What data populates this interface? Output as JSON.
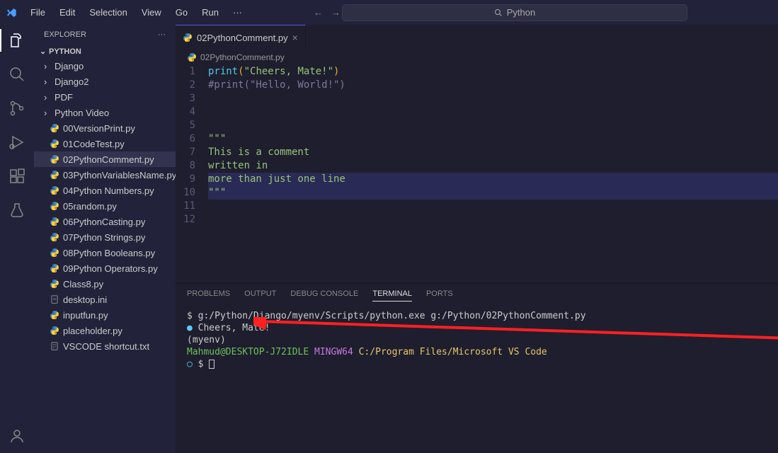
{
  "menu": [
    "File",
    "Edit",
    "Selection",
    "View",
    "Go",
    "Run"
  ],
  "search_placeholder": "Python",
  "sidebar": {
    "title": "EXPLORER",
    "folder": "PYTHON",
    "items": [
      {
        "type": "folder",
        "label": "Django"
      },
      {
        "type": "folder",
        "label": "Django2"
      },
      {
        "type": "folder",
        "label": "PDF"
      },
      {
        "type": "folder",
        "label": "Python Video"
      },
      {
        "type": "py",
        "label": "00VersionPrint.py"
      },
      {
        "type": "py",
        "label": "01CodeTest.py"
      },
      {
        "type": "py",
        "label": "02PythonComment.py",
        "selected": true
      },
      {
        "type": "py",
        "label": "03PythonVariablesName.py"
      },
      {
        "type": "py",
        "label": "04Python Numbers.py"
      },
      {
        "type": "py",
        "label": "05random.py"
      },
      {
        "type": "py",
        "label": "06PythonCasting.py"
      },
      {
        "type": "py",
        "label": "07Python Strings.py"
      },
      {
        "type": "py",
        "label": "08Python Booleans.py"
      },
      {
        "type": "py",
        "label": "09Python Operators.py"
      },
      {
        "type": "py",
        "label": "Class8.py"
      },
      {
        "type": "ini",
        "label": "desktop.ini"
      },
      {
        "type": "py",
        "label": "inputfun.py"
      },
      {
        "type": "py",
        "label": "placeholder.py"
      },
      {
        "type": "txt",
        "label": "VSCODE shortcut.txt"
      }
    ]
  },
  "tab": {
    "label": "02PythonComment.py"
  },
  "breadcrumb": "02PythonComment.py",
  "code": {
    "lines": 12,
    "l1_fn": "print",
    "l1_str": "\"Cheers, Mate!\"",
    "l2": "#print(\"Hello, World!\")",
    "l6": "\"\"\"",
    "l7": "This is a comment",
    "l8": "written in",
    "l9": "more than just one line",
    "l10": "\"\"\""
  },
  "panel": {
    "tabs": [
      "PROBLEMS",
      "OUTPUT",
      "DEBUG CONSOLE",
      "TERMINAL",
      "PORTS"
    ],
    "active": 3,
    "terminal": {
      "cmd": "$ g:/Python/Django/myenv/Scripts/python.exe g:/Python/02PythonComment.py",
      "output": "Cheers, Mate!",
      "venv": "(myenv)",
      "user": "Mahmud@DESKTOP-J72IDLE",
      "shell": " MINGW64 ",
      "path": "C:/Program Files/Microsoft VS Code",
      "prompt": "$ "
    }
  }
}
